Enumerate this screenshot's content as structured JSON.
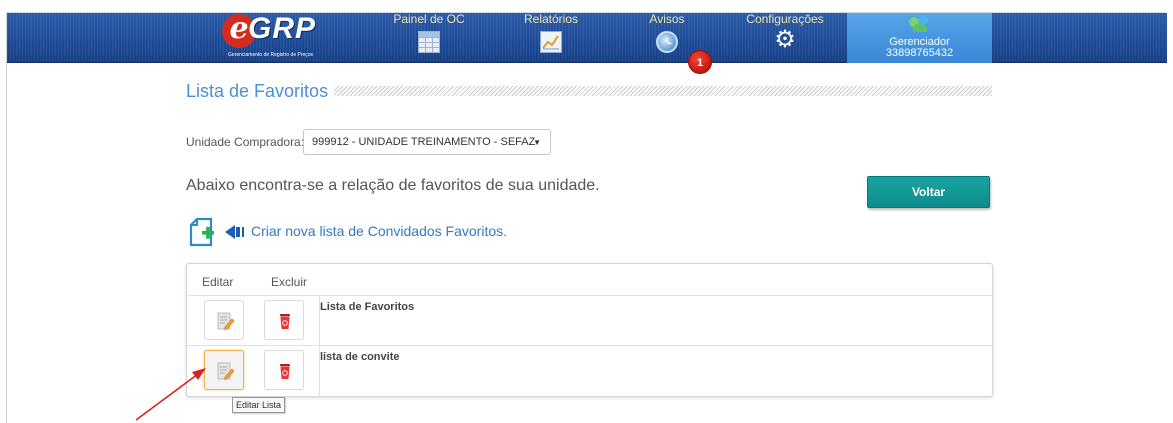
{
  "header": {
    "logo": {
      "e": "e",
      "grp": "GRP",
      "subtitle": "Gerenciamento de Registro de Preços"
    },
    "nav": [
      {
        "label": "Painel de OC",
        "icon": "table-icon"
      },
      {
        "label": "Relatórios",
        "icon": "chart-icon"
      },
      {
        "label": "Avisos",
        "icon": "clock-icon",
        "badge": "1"
      },
      {
        "label": "Configurações",
        "icon": "gear-icon"
      }
    ],
    "user": {
      "role": "Gerenciador",
      "id": "33898765432",
      "icon": "users-icon"
    }
  },
  "page": {
    "title": "Lista de Favoritos",
    "unit_label": "Unidade Compradora:",
    "unit_value": "999912 - UNIDADE TREINAMENTO - SEFAZ",
    "intro": "Abaixo encontra-se a relação de favoritos de sua unidade.",
    "back_button": "Voltar",
    "new_list_link": "Criar nova lista de Convidados Favoritos."
  },
  "table": {
    "headers": {
      "edit": "Editar",
      "delete": "Excluir"
    },
    "rows": [
      {
        "name": "Lista de Favoritos"
      },
      {
        "name": "lista de convite"
      }
    ]
  },
  "tooltip": "Editar Lista",
  "colors": {
    "nav_bg": "#1d4a96",
    "nav_label": "#f3e6a6",
    "title": "#4a90d9",
    "button": "#0e8d8d",
    "link": "#3478c6",
    "delete_icon": "#d32f2f",
    "annotation_arrow": "#e02020"
  }
}
